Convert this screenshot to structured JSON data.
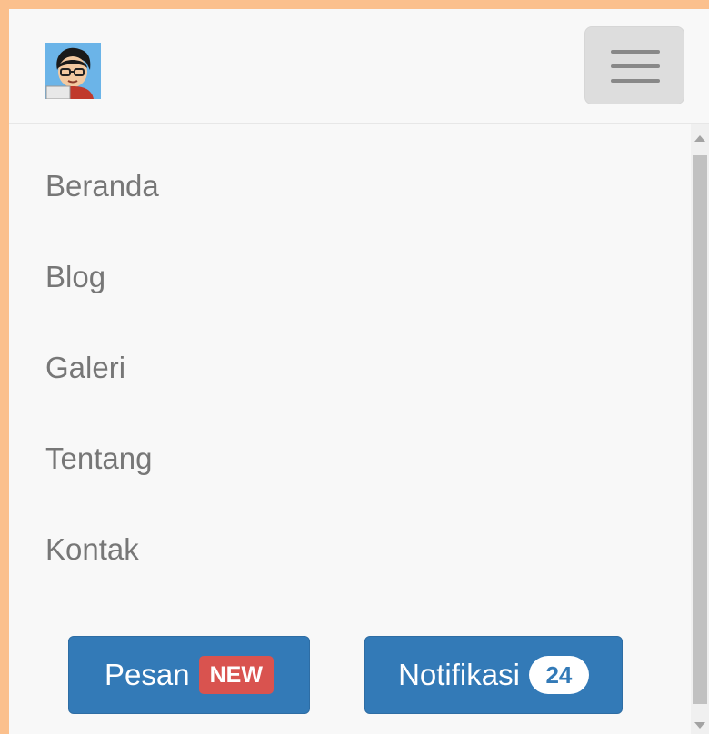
{
  "navbar": {
    "brand_icon": "avatar-icon",
    "toggle_icon": "hamburger-menu-icon"
  },
  "menu": {
    "items": [
      {
        "label": "Beranda"
      },
      {
        "label": "Blog"
      },
      {
        "label": "Galeri"
      },
      {
        "label": "Tentang"
      },
      {
        "label": "Kontak"
      }
    ]
  },
  "actions": {
    "pesan": {
      "label": "Pesan",
      "badge": "NEW"
    },
    "notifikasi": {
      "label": "Notifikasi",
      "count": "24"
    }
  },
  "colors": {
    "primary": "#337ab7",
    "danger": "#d9534f",
    "link_text": "#777777",
    "navbar_bg": "#f8f8f8",
    "frame_bg": "#fbc08d"
  }
}
